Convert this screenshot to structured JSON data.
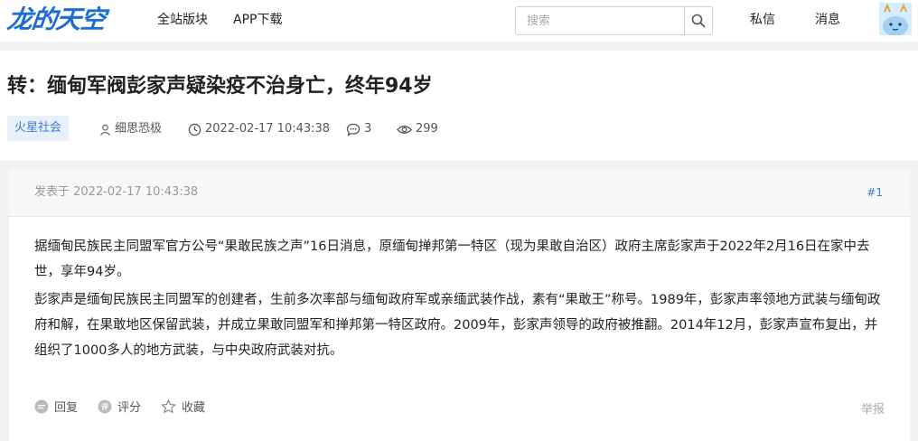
{
  "header": {
    "logo_text": "龙的天空",
    "nav_links": [
      "全站版块",
      "APP下载"
    ],
    "search_placeholder": "搜索",
    "right_links": [
      "私信",
      "消息"
    ]
  },
  "thread": {
    "title": "转：缅甸军阀彭家声疑染疫不治身亡，终年94岁",
    "forum": "火星社会",
    "author": "细思恐极",
    "time": "2022-02-17 10:43:38",
    "comments": "3",
    "views": "299"
  },
  "post": {
    "posted_at": "发表于 2022-02-17 10:43:38",
    "floor": "#1",
    "paragraphs": [
      "据缅甸民族民主同盟军官方公号“果敢民族之声”16日消息，原缅甸掸邦第一特区（现为果敢自治区）政府主席彭家声于2022年2月16日在家中去世，享年94岁。",
      "彭家声是缅甸民族民主同盟军的创建者，生前多次率部与缅甸政府军或亲缅武装作战，素有“果敢王”称号。1989年，彭家声率领地方武装与缅甸政府和解，在果敢地区保留武装，并成立果敢同盟军和掸邦第一特区政府。2009年，彭家声领导的政府被推翻。2014年12月，彭家声宣布复出，并组织了1000多人的地方武装，与中央政府武装对抗。"
    ],
    "actions": [
      "回复",
      "评分",
      "收藏"
    ],
    "report": "举报"
  },
  "colors": {
    "brand": "#1a6dd6",
    "link": "#3a7bd5",
    "tag_bg": "#e8f1fb"
  }
}
